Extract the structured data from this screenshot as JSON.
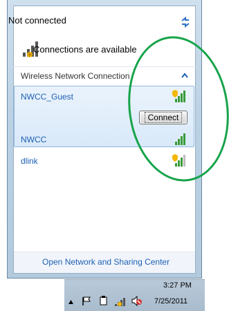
{
  "header": {
    "status": "Not connected",
    "availability": "Connections are available"
  },
  "section": {
    "title": "Wireless Network Connection"
  },
  "networks": [
    {
      "name": "NWCC_Guest",
      "secured": true,
      "strength": 4,
      "selected": true
    },
    {
      "name": "NWCC",
      "secured": false,
      "strength": 4,
      "selected": false
    },
    {
      "name": "dlink",
      "secured": true,
      "strength": 3,
      "selected": false
    }
  ],
  "buttons": {
    "connect": "Connect"
  },
  "footer": {
    "link": "Open Network and Sharing Center"
  },
  "taskbar": {
    "time": "3:27 PM",
    "date": "7/25/2011"
  },
  "colors": {
    "link_blue": "#1e5fb3",
    "annotation_green": "#16a34a"
  },
  "icons": [
    "refresh-icon",
    "signal-icon",
    "chevron-up-icon",
    "security-shield-icon",
    "flag-icon",
    "network-icon",
    "power-icon",
    "volume-muted-icon"
  ]
}
